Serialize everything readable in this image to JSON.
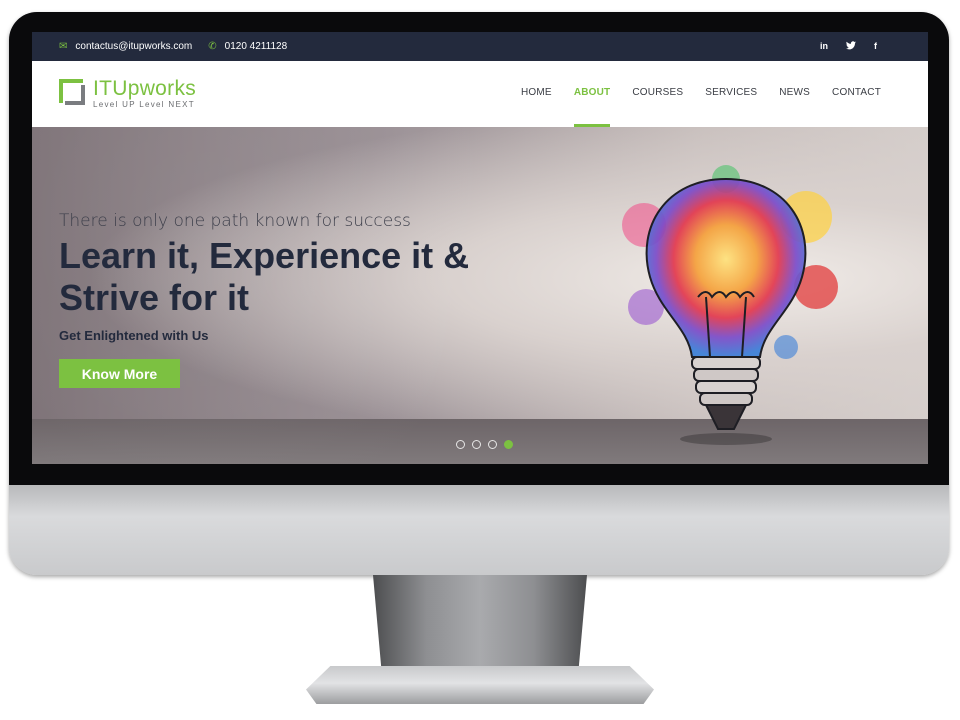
{
  "topbar": {
    "email": "contactus@itupworks.com",
    "phone": "0120 4211128",
    "social": [
      {
        "label": "in",
        "icon": "linkedin-icon"
      },
      {
        "label": "🐦",
        "icon": "twitter-icon"
      },
      {
        "label": "f",
        "icon": "facebook-icon"
      }
    ]
  },
  "logo": {
    "name": "ITUpworks",
    "tagline": "Level UP Level NEXT"
  },
  "nav": {
    "items": [
      "HOME",
      "ABOUT",
      "COURSES",
      "SERVICES",
      "NEWS",
      "CONTACT"
    ],
    "active": "ABOUT"
  },
  "hero": {
    "tagline": "There is only one path known for success",
    "headline": "Learn it, Experience it & Strive for it",
    "subheading": "Get Enlightened with Us",
    "cta": "Know More"
  },
  "slider": {
    "count": 4,
    "active_index": 3
  },
  "colors": {
    "accent": "#7cc141",
    "navy": "#232a3d"
  }
}
